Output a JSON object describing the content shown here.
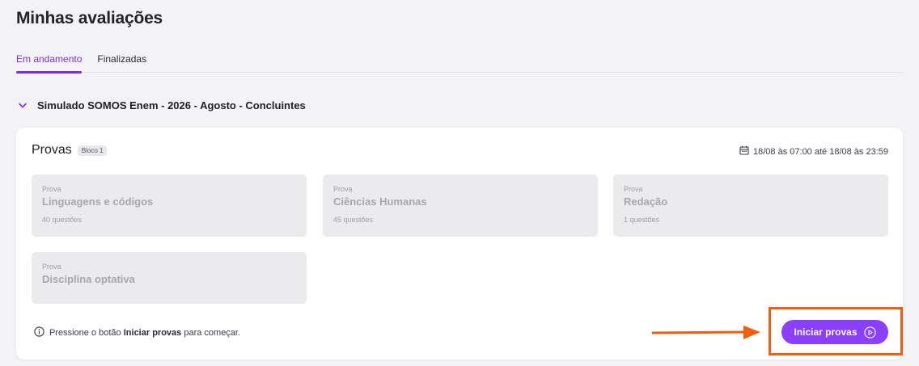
{
  "page": {
    "title": "Minhas avaliações"
  },
  "tabs": [
    {
      "label": "Em andamento",
      "active": true
    },
    {
      "label": "Finalizadas",
      "active": false
    }
  ],
  "group": {
    "title": "Simulado SOMOS Enem - 2026 - Agosto - Concluintes",
    "icon": "chevron-down-icon"
  },
  "card": {
    "title": "Provas",
    "badge": "Bloco 1",
    "schedule": "18/08 às 07:00 até 18/08 às 23:59",
    "schedule_icon": "calendar-icon",
    "tiles": [
      {
        "kicker": "Prova",
        "name": "Linguagens e códigos",
        "count": "40 questões"
      },
      {
        "kicker": "Prova",
        "name": "Ciências Humanas",
        "count": "45 questões"
      },
      {
        "kicker": "Prova",
        "name": "Redação",
        "count": "1 questões"
      },
      {
        "kicker": "Prova",
        "name": "Disciplina optativa",
        "count": ""
      }
    ],
    "hint": {
      "prefix": "Pressione o botão ",
      "bold": "Iniciar provas",
      "suffix": " para começar.",
      "icon": "info-icon"
    },
    "start_button": {
      "label": "Iniciar provas",
      "icon": "play-circle-icon"
    }
  },
  "colors": {
    "accent": "#8a3ffc",
    "tab_active": "#7b2fe0",
    "annotation": "#f25d0e"
  }
}
